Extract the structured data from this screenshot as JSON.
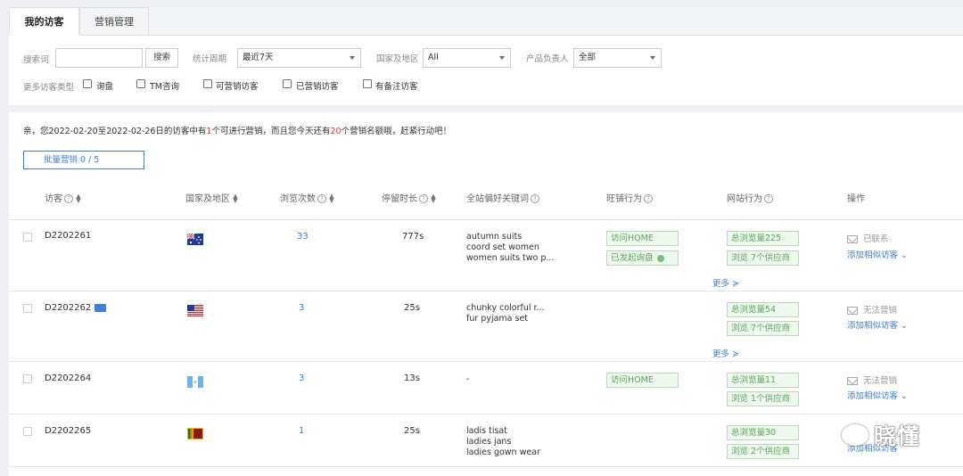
{
  "tabs": [
    {
      "label": "我的访客",
      "active": true
    },
    {
      "label": "营销管理",
      "active": false
    }
  ],
  "filters": {
    "search_label": "搜索词",
    "search_value": "",
    "search_button": "搜索",
    "period_label": "统计周期",
    "period_value": "最近7天",
    "region_label": "国家及地区",
    "region_value": "All",
    "owner_label": "产品负责人",
    "owner_value": "全部",
    "more_types_label": "更多访客类型",
    "checkboxes": [
      "询盘",
      "TM咨询",
      "可营销访客",
      "已营销访客",
      "有备注访客"
    ]
  },
  "notice": {
    "prefix": "亲，您2022-02-20至2022-02-26日的访客中有",
    "count1": "1",
    "mid": "个可进行营销，而且您今天还有",
    "count2": "20",
    "suffix": "个营销名额哦，赶紧行动吧！"
  },
  "batch_button": "批量营销 0 / 5",
  "columns": {
    "visitor": "访客",
    "region": "国家及地区",
    "views": "浏览次数",
    "duration": "停留时长",
    "keywords": "全站偏好关键词",
    "wangpu": "旺铺行为",
    "site": "网站行为",
    "action": "操作"
  },
  "rows": [
    {
      "id": "D2202261",
      "flag": "australia",
      "views": "33",
      "duration": "777s",
      "keywords": [
        "autumn suits",
        "coord set women",
        "women suits two p..."
      ],
      "wangpu": [
        "访问HOME",
        "已发起询盘"
      ],
      "site": [
        "总浏览量225",
        "浏览 7个供应商"
      ],
      "more": "更多",
      "status": "已联系",
      "add_similar": "添加相似访客"
    },
    {
      "id": "D2202262",
      "flag": "usa",
      "views": "3",
      "duration": "25s",
      "keywords": [
        "chunky colorful r...",
        "fur pyjama set"
      ],
      "wangpu": [],
      "site": [
        "总浏览量54",
        "浏览 7个供应商"
      ],
      "more": "更多",
      "status": "无法营销",
      "add_similar": "添加相似访客"
    },
    {
      "id": "D2202264",
      "flag": "guatemala",
      "views": "3",
      "duration": "13s",
      "keywords": [
        "-"
      ],
      "wangpu": [
        "访问HOME"
      ],
      "site": [
        "总浏览量11",
        "浏览 1个供应商"
      ],
      "more": "",
      "status": "无法营销",
      "add_similar": "添加相似访客"
    },
    {
      "id": "D2202265",
      "flag": "sri-lanka",
      "views": "1",
      "duration": "25s",
      "keywords": [
        "ladis tisat",
        "ladies jans",
        "ladies gown wear"
      ],
      "wangpu": [],
      "site": [
        "总浏览量30",
        "浏览 2个供应商"
      ],
      "more": "",
      "status": "",
      "add_similar": "添加相似访客"
    }
  ],
  "watermark": "晓懂"
}
